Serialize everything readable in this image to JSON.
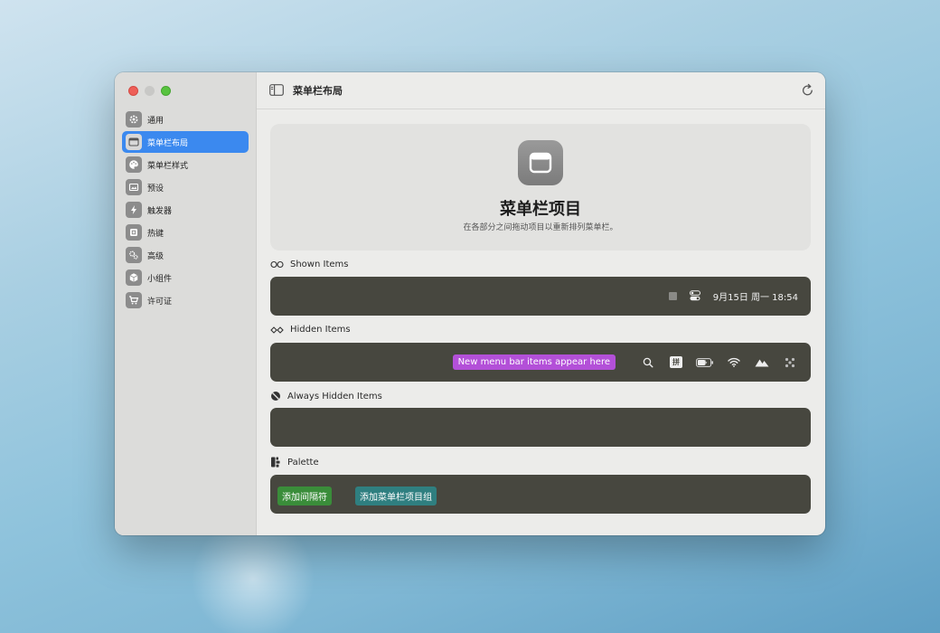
{
  "sidebar": {
    "items": [
      {
        "label": "通用",
        "icon": "gear-icon",
        "active": false
      },
      {
        "label": "菜单栏布局",
        "icon": "menubar-layout-icon",
        "active": true
      },
      {
        "label": "菜单栏样式",
        "icon": "palette-icon",
        "active": false
      },
      {
        "label": "预设",
        "icon": "presets-icon",
        "active": false
      },
      {
        "label": "触发器",
        "icon": "bolt-icon",
        "active": false
      },
      {
        "label": "热键",
        "icon": "hotkey-icon",
        "active": false
      },
      {
        "label": "高级",
        "icon": "gears-icon",
        "active": false
      },
      {
        "label": "小组件",
        "icon": "cube-icon",
        "active": false
      },
      {
        "label": "许可证",
        "icon": "cart-icon",
        "active": false
      }
    ]
  },
  "toolbar": {
    "title": "菜单栏布局"
  },
  "hero": {
    "title": "菜单栏项目",
    "subtitle": "在各部分之间拖动项目以重新排列菜单栏。"
  },
  "sections": {
    "shown": {
      "label": "Shown Items",
      "clock": "9月15日 周一  18:54"
    },
    "hidden": {
      "label": "Hidden Items",
      "placeholder_badge": "New menu bar items appear here",
      "input_method": "拼"
    },
    "always_hidden": {
      "label": "Always Hidden Items"
    },
    "palette": {
      "label": "Palette",
      "add_spacer": "添加间隔符",
      "add_group": "添加菜单栏项目组"
    }
  },
  "colors": {
    "accent": "#3b89ef",
    "bar": "#47473f",
    "badge_purple": "#b350d8",
    "chip_green": "#3a8d3a",
    "chip_teal": "#2f7f80"
  }
}
